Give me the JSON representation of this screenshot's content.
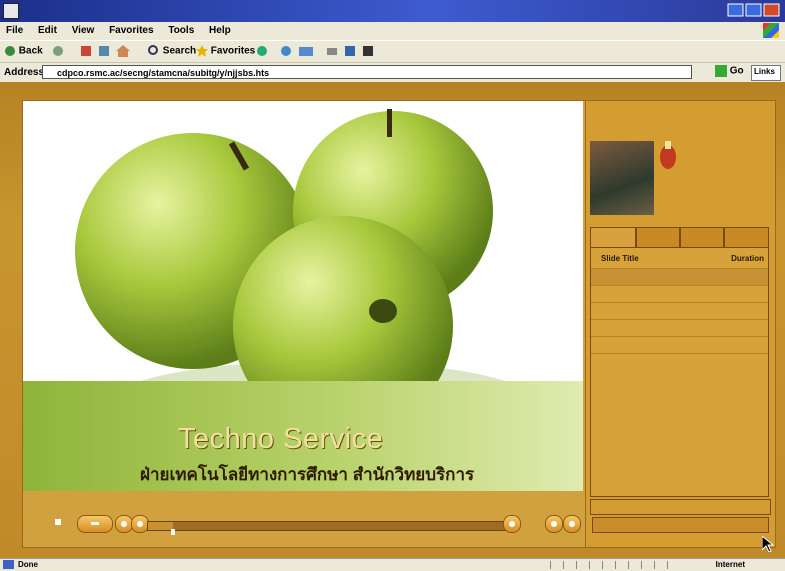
{
  "menubar": {
    "items": [
      "File",
      "Edit",
      "View",
      "Favorites",
      "Tools",
      "Help"
    ]
  },
  "toolbar": {
    "back_label": "Back",
    "search_label": "Search",
    "favorites_label": "Favorites"
  },
  "addressbar": {
    "label": "Address",
    "url": "cdpco.rsmc.ac/secng/stamcna/subitg/y/njjsbs.hts",
    "go_label": "Go",
    "links_label": "Links"
  },
  "player": {
    "headline": "Techno Service",
    "subline": "ฝ่ายเทคโนโลยีทางการศึกษา สำนักวิทยบริการ",
    "progress_fraction": 0.07
  },
  "sidebar": {
    "playlist_header": {
      "title_col": "Slide Title",
      "duration_col": "Duration"
    }
  },
  "statusbar": {
    "status_text": "Done",
    "zone_text": "Internet"
  },
  "colors": {
    "frame": "#d2a13f",
    "background": "#c99a3a",
    "accent_text": "#f0e0a0"
  }
}
